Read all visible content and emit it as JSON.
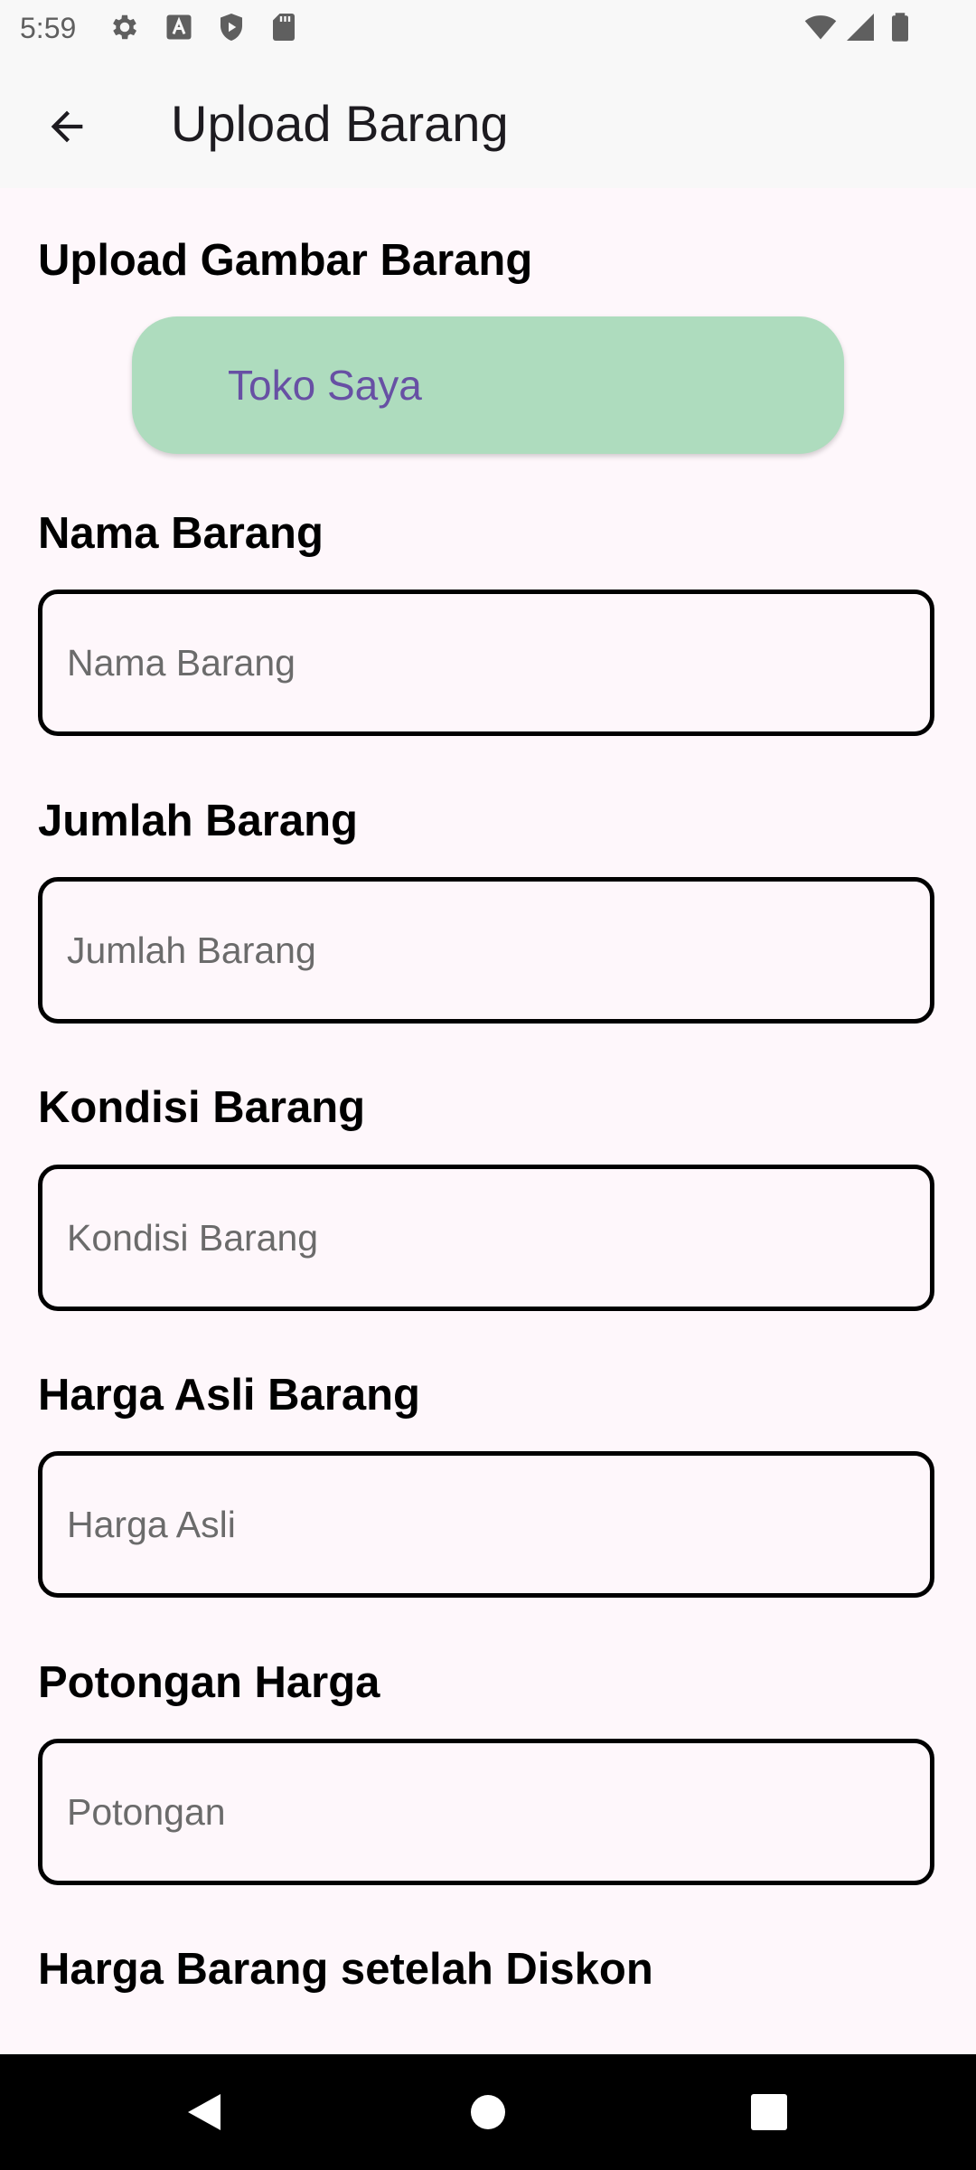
{
  "status_bar": {
    "time": "5:59",
    "left_icons": [
      "gear-icon",
      "text-a-icon",
      "shield-play-icon",
      "sd-card-icon"
    ],
    "right_icons": [
      "wifi-icon",
      "signal-icon",
      "battery-icon"
    ]
  },
  "app_bar": {
    "back_icon": "arrow-back-icon",
    "title": "Upload Barang"
  },
  "form": {
    "upload_image_label": "Upload Gambar Barang",
    "shop_button_label": "Toko Saya",
    "item_name_label": "Nama Barang",
    "item_name_placeholder": "Nama Barang",
    "item_name_value": "",
    "quantity_label": "Jumlah Barang",
    "quantity_placeholder": "Jumlah Barang",
    "quantity_value": "",
    "condition_label": "Kondisi Barang",
    "condition_placeholder": "Kondisi Barang",
    "condition_value": "",
    "original_price_label": "Harga Asli Barang",
    "original_price_placeholder": "Harga Asli",
    "original_price_value": "",
    "discount_label": "Potongan Harga",
    "discount_placeholder": "Potongan",
    "discount_value": "",
    "price_after_discount_label": "Harga Barang setelah Diskon"
  },
  "colors": {
    "background": "#FEF7FB",
    "app_bar": "#F8F8F8",
    "shop_button_bg": "#AEDCBE",
    "shop_button_text": "#6750A4",
    "input_border": "#000000",
    "placeholder": "#6B6B6B",
    "nav_bar": "#000000"
  },
  "nav_bar": {
    "icons": [
      "back-triangle-icon",
      "home-circle-icon",
      "recents-square-icon"
    ]
  }
}
